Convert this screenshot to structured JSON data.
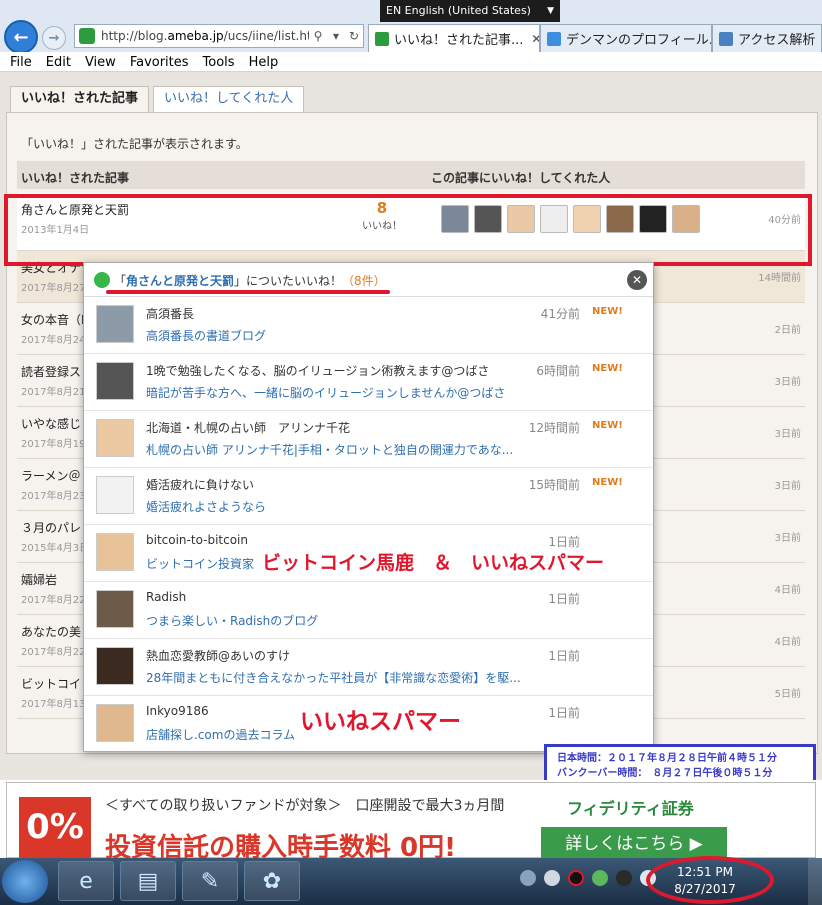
{
  "browser": {
    "lang": "EN English (United States)",
    "url_prefix": "http://blog.",
    "url_host": "ameba.jp",
    "url_path": "/ucs/iine/list.html",
    "tabs": [
      {
        "label": "いいね！された記事...",
        "x_label": "✕"
      },
      {
        "label": "デンマンのプロフィール..."
      },
      {
        "label": "アクセス解析 | ..."
      }
    ]
  },
  "menu": [
    "File",
    "Edit",
    "View",
    "Favorites",
    "Tools",
    "Help"
  ],
  "page": {
    "tab_active": "いいね！された記事",
    "tab_other": "いいね！してくれた人",
    "desc": "「いいね！」された記事が表示されます。",
    "col1": "いいね！された記事",
    "col2": "この記事にいいね！してくれた人",
    "rows": [
      {
        "title": "角さんと原発と天罰",
        "date": "2013年1月4日",
        "count": "8",
        "count_label": "いいね！",
        "ago": "40分前"
      },
      {
        "title": "美女とオナラ",
        "date": "2017年8月27日",
        "ago": "14時間前"
      },
      {
        "title": "女の本音（F",
        "date": "2017年8月24日",
        "ago": "2日前"
      },
      {
        "title": "読者登録ス",
        "date": "2017年8月21日",
        "ago": "3日前"
      },
      {
        "title": "いやな感じ",
        "date": "2017年8月19日",
        "ago": "3日前"
      },
      {
        "title": "ラーメン＠",
        "date": "2017年8月23日",
        "ago": "3日前"
      },
      {
        "title": "３月のパレ",
        "date": "2015年4月3日",
        "ago": "3日前"
      },
      {
        "title": "孀婦岩",
        "date": "2017年8月22日",
        "ago": "4日前"
      },
      {
        "title": "あなたの美",
        "date": "2017年8月22日",
        "ago": "4日前"
      },
      {
        "title": "ビットコイン",
        "date": "2017年8月13日",
        "ago": "5日前"
      }
    ]
  },
  "popup": {
    "pre": "「",
    "link": "角さんと原発と天罰",
    "post": "」についたいいね！",
    "count": "（8件）",
    "close": "✕",
    "items": [
      {
        "name": "高須番長",
        "blog": "高須番長の書道ブログ",
        "time": "41分前",
        "new": "NEW!"
      },
      {
        "name": "1晩で勉強したくなる、脳のイリュージョン術教えます@つばさ",
        "blog": "暗記が苦手な方へ、一緒に脳のイリュージョンしませんか@つばさ",
        "time": "6時間前",
        "new": "NEW!"
      },
      {
        "name": "北海道・札幌の占い師　アリンナ千花",
        "blog": "札幌の占い師 アリンナ千花|手相・タロットと独自の開運力であな...",
        "time": "12時間前",
        "new": "NEW!"
      },
      {
        "name": "婚活疲れに負けない",
        "blog": "婚活疲れよさようなら",
        "time": "15時間前",
        "new": "NEW!"
      },
      {
        "name": "bitcoin-to-bitcoin",
        "blog": "ビットコイン投資家",
        "time": "1日前",
        "new": ""
      },
      {
        "name": "Radish",
        "blog": "つまら楽しい・Radishのブログ",
        "time": "1日前",
        "new": ""
      },
      {
        "name": "熱血恋愛教師@あいのすけ",
        "blog": "28年間まともに付き合えなかった平社員が【非常識な恋愛術】を駆...",
        "time": "1日前",
        "new": ""
      },
      {
        "name": "Inkyo9186",
        "blog": "店舗探し.comの過去コラム",
        "time": "1日前",
        "new": ""
      }
    ]
  },
  "annotations": {
    "red1": "ビットコイン馬鹿　＆　いいねスパマー",
    "red2": "いいねスパマー",
    "jp_time": "日本時間：２０１７年８月２８日午前４時５１分",
    "van_time": "バンクーバー時間：　８月２７日午後０時５１分"
  },
  "ad": {
    "zero": "0%",
    "line1": "＜すべての取り扱いファンドが対象＞　口座開設で最大3ヵ月間",
    "line2": "投資信託の購入時手数料 0円!",
    "brand": "フィデリティ証券",
    "button": "詳しくはこちら ▶"
  },
  "taskbar": {
    "time": "12:51 PM",
    "date": "8/27/2017"
  }
}
